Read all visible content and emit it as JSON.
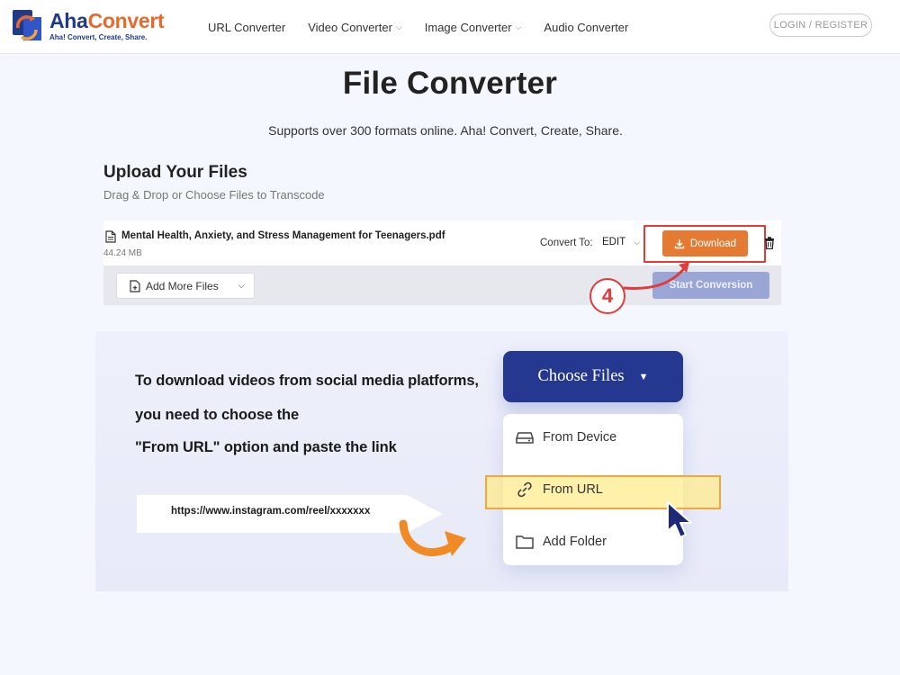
{
  "header": {
    "logo": {
      "name_part1": "Aha",
      "name_part2": "Convert",
      "tagline": "Aha! Convert, Create, Share."
    },
    "nav": [
      {
        "label": "URL Converter",
        "dropdown": false
      },
      {
        "label": "Video Converter",
        "dropdown": true
      },
      {
        "label": "Image Converter",
        "dropdown": true
      },
      {
        "label": "Audio Converter",
        "dropdown": false
      }
    ],
    "login_label": "LOGIN / REGISTER"
  },
  "hero": {
    "title": "File Converter",
    "subtitle": "Supports over 300 formats online. Aha! Convert, Create, Share."
  },
  "upload": {
    "title": "Upload Your Files",
    "subtitle": "Drag & Drop or Choose Files to Transcode",
    "file": {
      "name": "Mental Health, Anxiety, and Stress Management for Teenagers.pdf",
      "size": "44.24 MB",
      "convert_to_label": "Convert To:",
      "convert_to_value": "EDIT",
      "download_label": "Download"
    },
    "add_more_label": "Add More Files",
    "start_label": "Start Conversion",
    "step_number": "4"
  },
  "tip": {
    "lines": [
      "To download videos from social media platforms,",
      "you need to choose the",
      "\"From URL\" option and paste the link"
    ],
    "example_url": "https://www.instagram.com/reel/xxxxxxx",
    "choose_files_label": "Choose Files",
    "menu": [
      {
        "label": "From Device",
        "icon": "hard-drive-icon"
      },
      {
        "label": "From URL",
        "icon": "link-icon"
      },
      {
        "label": "Add Folder",
        "icon": "folder-icon"
      }
    ]
  },
  "colors": {
    "brand_blue": "#1f3a8a",
    "accent_orange": "#e57a32",
    "highlight_red": "#e23b3b",
    "start_button": "#9aa6d6",
    "choose_button": "#25388f"
  }
}
